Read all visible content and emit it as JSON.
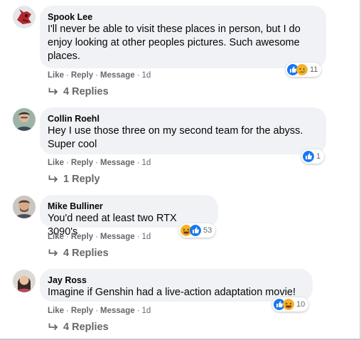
{
  "comments": [
    {
      "author": "Spook Lee",
      "text": "I'll never be able to visit these places in person, but I do enjoy looking at other peoples pictures. Such awesome places.",
      "actions": {
        "like": "Like",
        "reply": "Reply",
        "message": "Message",
        "time": "1d"
      },
      "reactions": {
        "icons": [
          "like-icon",
          "sad-icon"
        ],
        "count": "11"
      },
      "replies": "4 Replies"
    },
    {
      "author": "Collin Roehl",
      "text": "Hey I use those three on my second team for the abyss. Super cool",
      "actions": {
        "like": "Like",
        "reply": "Reply",
        "message": "Message",
        "time": "1d"
      },
      "reactions": {
        "icons": [
          "like-icon"
        ],
        "count": "1"
      },
      "replies": "1 Reply"
    },
    {
      "author": "Mike Bulliner",
      "text": "You'd need at least two RTX 3090's",
      "actions": {
        "like": "Like",
        "reply": "Reply",
        "message": "Message",
        "time": "1d"
      },
      "reactions": {
        "icons": [
          "haha-icon",
          "like-icon"
        ],
        "count": "53"
      },
      "replies": "4 Replies"
    },
    {
      "author": "Jay Ross",
      "text": "Imagine if Genshin had a live-action adaptation movie!",
      "actions": {
        "like": "Like",
        "reply": "Reply",
        "message": "Message",
        "time": "1d"
      },
      "reactions": {
        "icons": [
          "like-icon",
          "haha-icon"
        ],
        "count": "10"
      },
      "replies": "4 Replies"
    }
  ],
  "colors": {
    "bubble": "#f0f2f5",
    "meta_text": "#65676b",
    "like_blue": "#1877f2",
    "reaction_yellow": "#f7b125"
  }
}
